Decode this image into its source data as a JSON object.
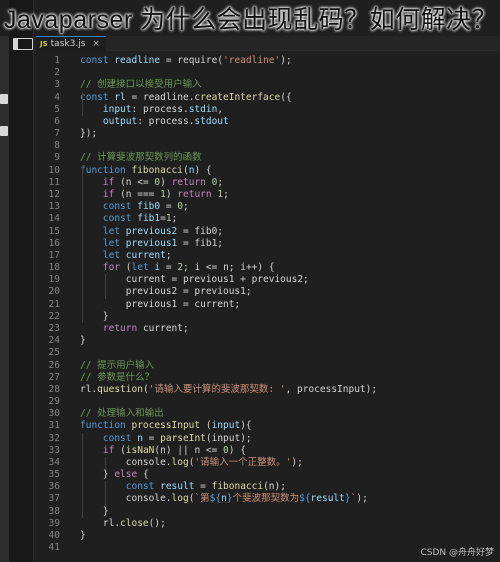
{
  "banner_title": "Javaparser 为什么会出现乱码？如何解决？",
  "tab": {
    "name": "task3.js",
    "icon": "js-file-icon"
  },
  "watermark": "CSDN @舟舟好梦",
  "colors": {
    "keyword": "#569cd6",
    "control": "#c586c0",
    "function": "#dcdcaa",
    "variable": "#9cdcfe",
    "string": "#ce9178",
    "number": "#b5cea8",
    "comment": "#6a9955",
    "plain": "#d4d4d4"
  },
  "lines": [
    [
      [
        "kw",
        "const "
      ],
      [
        "var",
        "readline"
      ],
      [
        "pl",
        " = require("
      ],
      [
        "str",
        "'readline'"
      ],
      [
        "pl",
        ");"
      ]
    ],
    [],
    [
      [
        "com",
        "// 创建接口以接受用户输入"
      ]
    ],
    [
      [
        "kw",
        "const "
      ],
      [
        "var",
        "rl"
      ],
      [
        "pl",
        " = readline."
      ],
      [
        "fn",
        "createInterface"
      ],
      [
        "pl",
        "({"
      ]
    ],
    [
      [
        "pl",
        "    "
      ],
      [
        "var",
        "input"
      ],
      [
        "pl",
        ": process."
      ],
      [
        "var",
        "stdin"
      ],
      [
        "pl",
        ","
      ]
    ],
    [
      [
        "pl",
        "    "
      ],
      [
        "var",
        "output"
      ],
      [
        "pl",
        ": process."
      ],
      [
        "var",
        "stdout"
      ]
    ],
    [
      [
        "pl",
        "});"
      ]
    ],
    [],
    [
      [
        "com",
        "// 计算斐波那契数列的函数"
      ]
    ],
    [
      [
        "kw",
        "function "
      ],
      [
        "fn",
        "fibonacci"
      ],
      [
        "pl",
        "("
      ],
      [
        "var",
        "n"
      ],
      [
        "pl",
        ") {"
      ]
    ],
    [
      [
        "pl",
        "    "
      ],
      [
        "ctl",
        "if"
      ],
      [
        "pl",
        " (n <= "
      ],
      [
        "num",
        "0"
      ],
      [
        "pl",
        ") "
      ],
      [
        "ctl",
        "return"
      ],
      [
        "num",
        " 0"
      ],
      [
        "pl",
        ";"
      ]
    ],
    [
      [
        "pl",
        "    "
      ],
      [
        "ctl",
        "if"
      ],
      [
        "pl",
        " (n === "
      ],
      [
        "num",
        "1"
      ],
      [
        "pl",
        ") "
      ],
      [
        "ctl",
        "return"
      ],
      [
        "num",
        " 1"
      ],
      [
        "pl",
        ";"
      ]
    ],
    [
      [
        "pl",
        "    "
      ],
      [
        "kw",
        "const "
      ],
      [
        "var",
        "fib0"
      ],
      [
        "pl",
        " = "
      ],
      [
        "num",
        "0"
      ],
      [
        "pl",
        ";"
      ]
    ],
    [
      [
        "pl",
        "    "
      ],
      [
        "kw",
        "const "
      ],
      [
        "var",
        "fib1"
      ],
      [
        "pl",
        "="
      ],
      [
        "num",
        "1"
      ],
      [
        "pl",
        ";"
      ]
    ],
    [
      [
        "pl",
        "    "
      ],
      [
        "kw",
        "let "
      ],
      [
        "var",
        "previous2"
      ],
      [
        "pl",
        " = fib0;"
      ]
    ],
    [
      [
        "pl",
        "    "
      ],
      [
        "kw",
        "let "
      ],
      [
        "var",
        "previous1"
      ],
      [
        "pl",
        " = fib1;"
      ]
    ],
    [
      [
        "pl",
        "    "
      ],
      [
        "kw",
        "let "
      ],
      [
        "var",
        "current"
      ],
      [
        "pl",
        ";"
      ]
    ],
    [
      [
        "pl",
        "    "
      ],
      [
        "ctl",
        "for"
      ],
      [
        "pl",
        " ("
      ],
      [
        "kw",
        "let "
      ],
      [
        "var",
        "i"
      ],
      [
        "pl",
        " = "
      ],
      [
        "num",
        "2"
      ],
      [
        "pl",
        "; i <= n; i++) {"
      ]
    ],
    [
      [
        "pl",
        "        current = previous1 + previous2;"
      ]
    ],
    [
      [
        "pl",
        "        previous2 = previous1;"
      ]
    ],
    [
      [
        "pl",
        "        previous1 = current;"
      ]
    ],
    [
      [
        "pl",
        "    }"
      ]
    ],
    [
      [
        "pl",
        "    "
      ],
      [
        "ctl",
        "return"
      ],
      [
        "pl",
        " current;"
      ]
    ],
    [
      [
        "pl",
        "}"
      ]
    ],
    [],
    [
      [
        "com",
        "// 提示用户输入"
      ]
    ],
    [
      [
        "com",
        "// 参数是什么？"
      ]
    ],
    [
      [
        "pl",
        "rl."
      ],
      [
        "fn",
        "question"
      ],
      [
        "pl",
        "("
      ],
      [
        "str",
        "'请输入要计算的斐波那契数: '"
      ],
      [
        "pl",
        ", processInput);"
      ]
    ],
    [],
    [
      [
        "com",
        "// 处理输入和输出"
      ]
    ],
    [
      [
        "kw",
        "function "
      ],
      [
        "fn",
        "processInput"
      ],
      [
        "pl",
        " ("
      ],
      [
        "var",
        "input"
      ],
      [
        "pl",
        "){"
      ]
    ],
    [
      [
        "pl",
        "    "
      ],
      [
        "kw",
        "const "
      ],
      [
        "var",
        "n"
      ],
      [
        "pl",
        " = "
      ],
      [
        "fn",
        "parseInt"
      ],
      [
        "pl",
        "(input);"
      ]
    ],
    [
      [
        "pl",
        "    "
      ],
      [
        "ctl",
        "if"
      ],
      [
        "pl",
        " ("
      ],
      [
        "fn",
        "isNaN"
      ],
      [
        "pl",
        "(n) || n <= "
      ],
      [
        "num",
        "0"
      ],
      [
        "pl",
        ") {"
      ]
    ],
    [
      [
        "pl",
        "        console."
      ],
      [
        "fn",
        "log"
      ],
      [
        "pl",
        "("
      ],
      [
        "str",
        "'请输入一个正整数。'"
      ],
      [
        "pl",
        ");"
      ]
    ],
    [
      [
        "pl",
        "    } "
      ],
      [
        "ctl",
        "else"
      ],
      [
        "pl",
        " {"
      ]
    ],
    [
      [
        "pl",
        "        "
      ],
      [
        "kw",
        "const "
      ],
      [
        "var",
        "result"
      ],
      [
        "pl",
        " = "
      ],
      [
        "fn",
        "fibonacci"
      ],
      [
        "pl",
        "(n);"
      ]
    ],
    [
      [
        "pl",
        "        console."
      ],
      [
        "fn",
        "log"
      ],
      [
        "pl",
        "("
      ],
      [
        "str",
        "`第"
      ],
      [
        "kw",
        "${"
      ],
      [
        "var",
        "n"
      ],
      [
        "kw",
        "}"
      ],
      [
        "str",
        "个斐波那契数为"
      ],
      [
        "kw",
        "${"
      ],
      [
        "var",
        "result"
      ],
      [
        "kw",
        "}"
      ],
      [
        "str",
        "`"
      ],
      [
        "pl",
        ");"
      ]
    ],
    [
      [
        "pl",
        "    }"
      ]
    ],
    [
      [
        "pl",
        "    rl."
      ],
      [
        "fn",
        "close"
      ],
      [
        "pl",
        "();"
      ]
    ],
    [
      [
        "pl",
        "}"
      ]
    ],
    []
  ]
}
